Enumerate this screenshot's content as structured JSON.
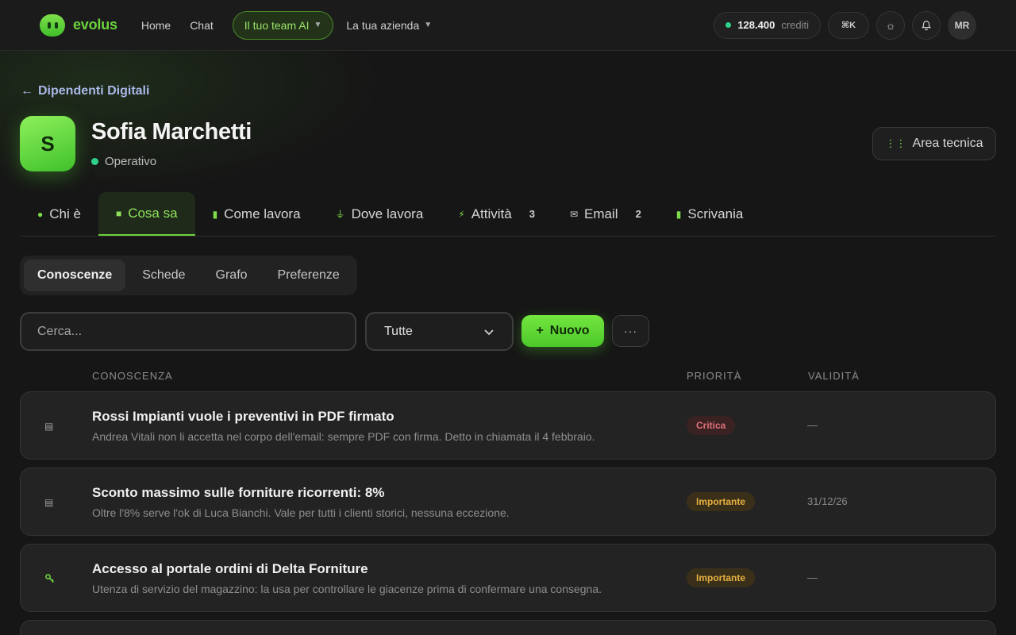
{
  "nav": {
    "brand": "evolus",
    "links": [
      "Home",
      "Chat"
    ],
    "team_pill": "Il tuo team AI",
    "company_drop": "La tua azienda",
    "credits_value": "128.400",
    "credits_label": "crediti",
    "shortcut": "⌘K",
    "user_initials": "MR"
  },
  "header": {
    "back_label": "Dipendenti Digitali",
    "avatar_letter": "S",
    "name": "Sofia Marchetti",
    "status": "Operativo",
    "tech_button": "Area tecnica"
  },
  "tabs": [
    {
      "label": "Chi è",
      "count": ""
    },
    {
      "label": "Cosa sa",
      "count": ""
    },
    {
      "label": "Come lavora",
      "count": ""
    },
    {
      "label": "Dove lavora",
      "count": ""
    },
    {
      "label": "Attività",
      "count": "3"
    },
    {
      "label": "Email",
      "count": "2"
    },
    {
      "label": "Scrivania",
      "count": ""
    }
  ],
  "subtabs": [
    "Conoscenze",
    "Schede",
    "Grafo",
    "Preferenze"
  ],
  "toolbar": {
    "search_placeholder": "Cerca...",
    "filter_value": "Tutte",
    "new_label": "Nuovo"
  },
  "table": {
    "headers": {
      "knowledge": "CONOSCENZA",
      "priority": "PRIORITÀ",
      "validity": "VALIDITÀ"
    },
    "rows": [
      {
        "title": "Rossi Impianti vuole i preventivi in PDF firmato",
        "desc": "Andrea Vitali non li accetta nel corpo dell'email: sempre PDF con firma. Detto in chiamata il 4 febbraio.",
        "priority": "Critica",
        "validity": "—"
      },
      {
        "title": "Sconto massimo sulle forniture ricorrenti: 8%",
        "desc": "Oltre l'8% serve l'ok di Luca Bianchi. Vale per tutti i clienti storici, nessuna eccezione.",
        "priority": "Importante",
        "validity": "31/12/26"
      },
      {
        "title": "Accesso al portale ordini di Delta Forniture",
        "desc": "Utenza di servizio del magazzino: la usa per controllare le giacenze prima di confermare una consegna.",
        "priority": "Importante",
        "validity": "—"
      }
    ]
  }
}
